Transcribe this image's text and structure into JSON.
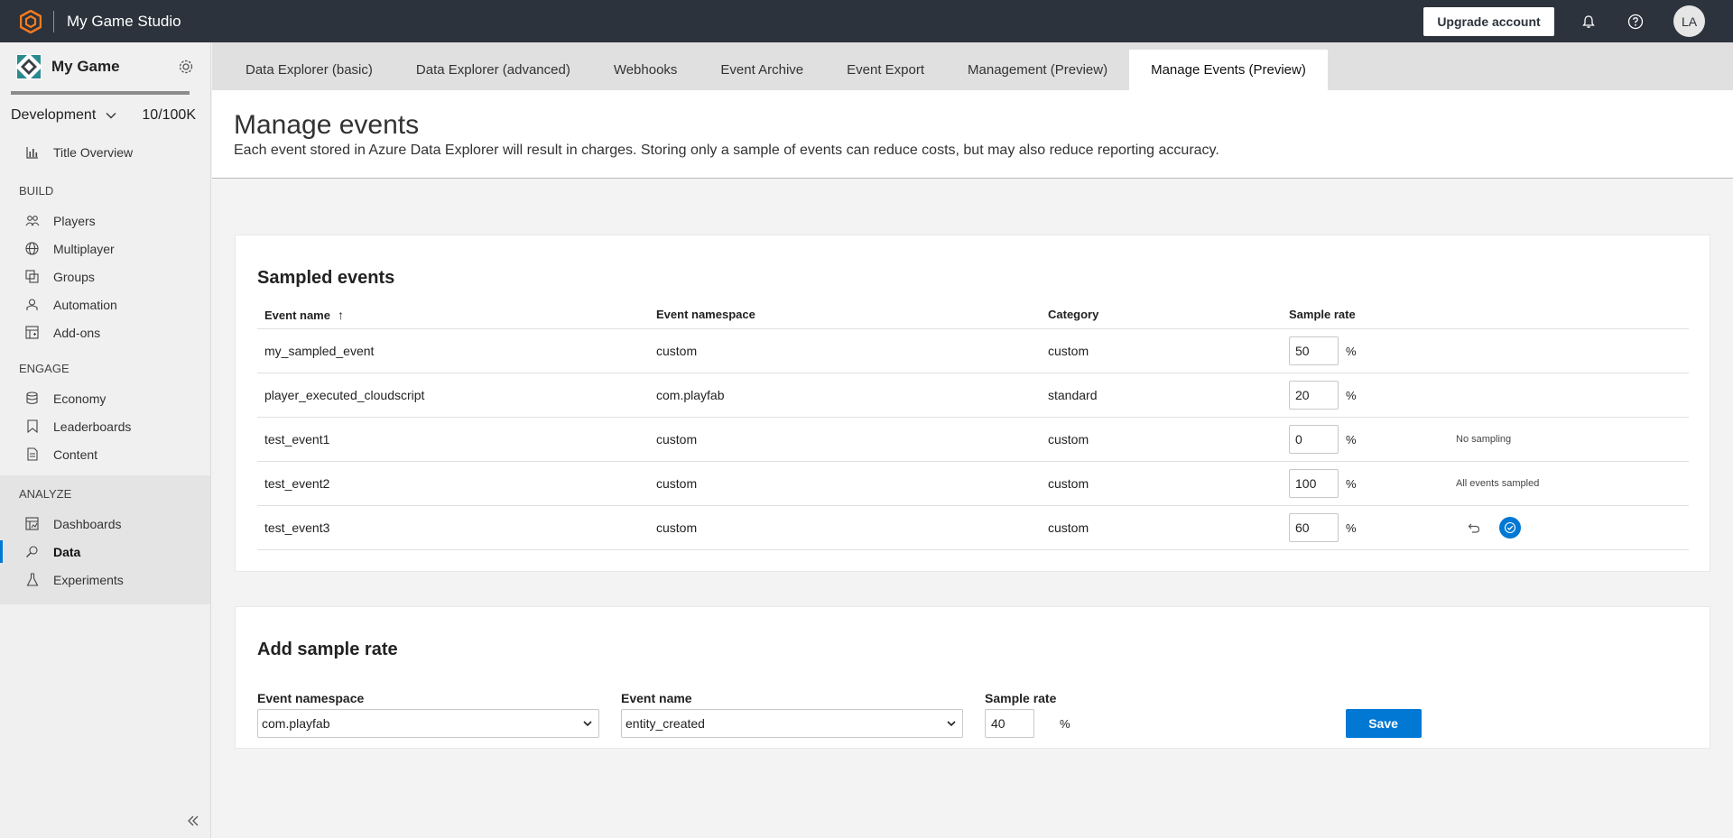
{
  "topbar": {
    "studio_name": "My Game Studio",
    "upgrade_label": "Upgrade account",
    "avatar_initials": "LA",
    "colors": {
      "bar": "#2c333c",
      "logo": "#f47b20"
    }
  },
  "sidebar": {
    "game_name": "My Game",
    "environment": "Development",
    "usage": "10/100K",
    "overview": "Title Overview",
    "build_section": "BUILD",
    "build_items": [
      "Players",
      "Multiplayer",
      "Groups",
      "Automation",
      "Add-ons"
    ],
    "engage_section": "ENGAGE",
    "engage_items": [
      "Economy",
      "Leaderboards",
      "Content"
    ],
    "analyze_section": "ANALYZE",
    "analyze_items": [
      "Dashboards",
      "Data",
      "Experiments"
    ],
    "active_item": "Data"
  },
  "tabs": [
    "Data Explorer (basic)",
    "Data Explorer (advanced)",
    "Webhooks",
    "Event Archive",
    "Event Export",
    "Management (Preview)",
    "Manage Events (Preview)"
  ],
  "active_tab": "Manage Events (Preview)",
  "header": {
    "title": "Manage events",
    "description": "Each event stored in Azure Data Explorer will result in charges. Storing only a sample of events can reduce costs, but may also reduce reporting accuracy."
  },
  "sampled": {
    "title": "Sampled events",
    "columns": [
      "Event name",
      "Event namespace",
      "Category",
      "Sample rate"
    ],
    "sort_indicator": "↑",
    "percent_sign": "%",
    "rows": [
      {
        "name": "my_sampled_event",
        "namespace": "custom",
        "category": "custom",
        "rate": "50",
        "note": ""
      },
      {
        "name": "player_executed_cloudscript",
        "namespace": "com.playfab",
        "category": "standard",
        "rate": "20",
        "note": ""
      },
      {
        "name": "test_event1",
        "namespace": "custom",
        "category": "custom",
        "rate": "0",
        "note": "No sampling"
      },
      {
        "name": "test_event2",
        "namespace": "custom",
        "category": "custom",
        "rate": "100",
        "note": "All events sampled"
      },
      {
        "name": "test_event3",
        "namespace": "custom",
        "category": "custom",
        "rate": "60",
        "note": ""
      }
    ]
  },
  "add_rate": {
    "title": "Add sample rate",
    "namespace_label": "Event namespace",
    "namespace_value": "com.playfab",
    "name_label": "Event name",
    "name_value": "entity_created",
    "rate_label": "Sample rate",
    "rate_value": "40",
    "percent_sign": "%",
    "save_label": "Save"
  }
}
